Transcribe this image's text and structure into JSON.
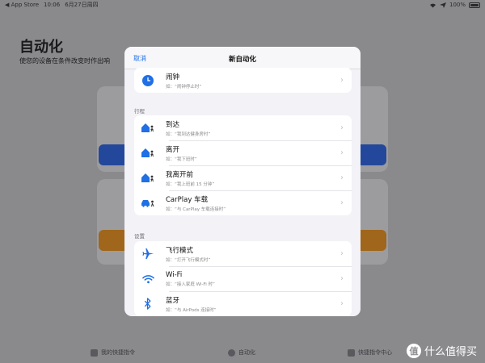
{
  "status_bar": {
    "app_back": "◀ App Store",
    "time": "10:06",
    "date": "6月27日周四",
    "battery": "100%"
  },
  "background": {
    "title": "自动化",
    "subtitle": "使您的设备在条件改变时作出响",
    "tabs": [
      {
        "label": "我的快捷指令"
      },
      {
        "label": "自动化"
      },
      {
        "label": "快捷指令中心"
      }
    ],
    "watermark": "什么值得买",
    "watermark_badge": "值"
  },
  "sheet": {
    "cancel_label": "取消",
    "title": "新自动化",
    "top_group": [
      {
        "icon": "clock-icon",
        "label": "闹钟",
        "hint": "如：“闹钟停止时”"
      }
    ],
    "sections": [
      {
        "label": "行程",
        "items": [
          {
            "icon": "arrive-home-icon",
            "label": "到达",
            "hint": "如：“我到达健身房时”"
          },
          {
            "icon": "leave-home-icon",
            "label": "离开",
            "hint": "如：“我下班时”"
          },
          {
            "icon": "before-leave-icon",
            "label": "我离开前",
            "hint": "如：“我上班前 15 分钟”"
          },
          {
            "icon": "carplay-icon",
            "label": "CarPlay 车载",
            "hint": "如：“与 CarPlay 车载连接时”"
          }
        ]
      },
      {
        "label": "设置",
        "items": [
          {
            "icon": "airplane-icon",
            "label": "飞行模式",
            "hint": "如：“打开飞行模式时”"
          },
          {
            "icon": "wifi-icon",
            "label": "Wi-Fi",
            "hint": "如：“接入家庭 Wi-Fi 时”"
          },
          {
            "icon": "bluetooth-icon",
            "label": "蓝牙",
            "hint": "如：“与 AirPods 连接时”"
          }
        ]
      }
    ]
  },
  "colors": {
    "accent": "#1f6fe5",
    "overlay": "#8e8e91"
  }
}
